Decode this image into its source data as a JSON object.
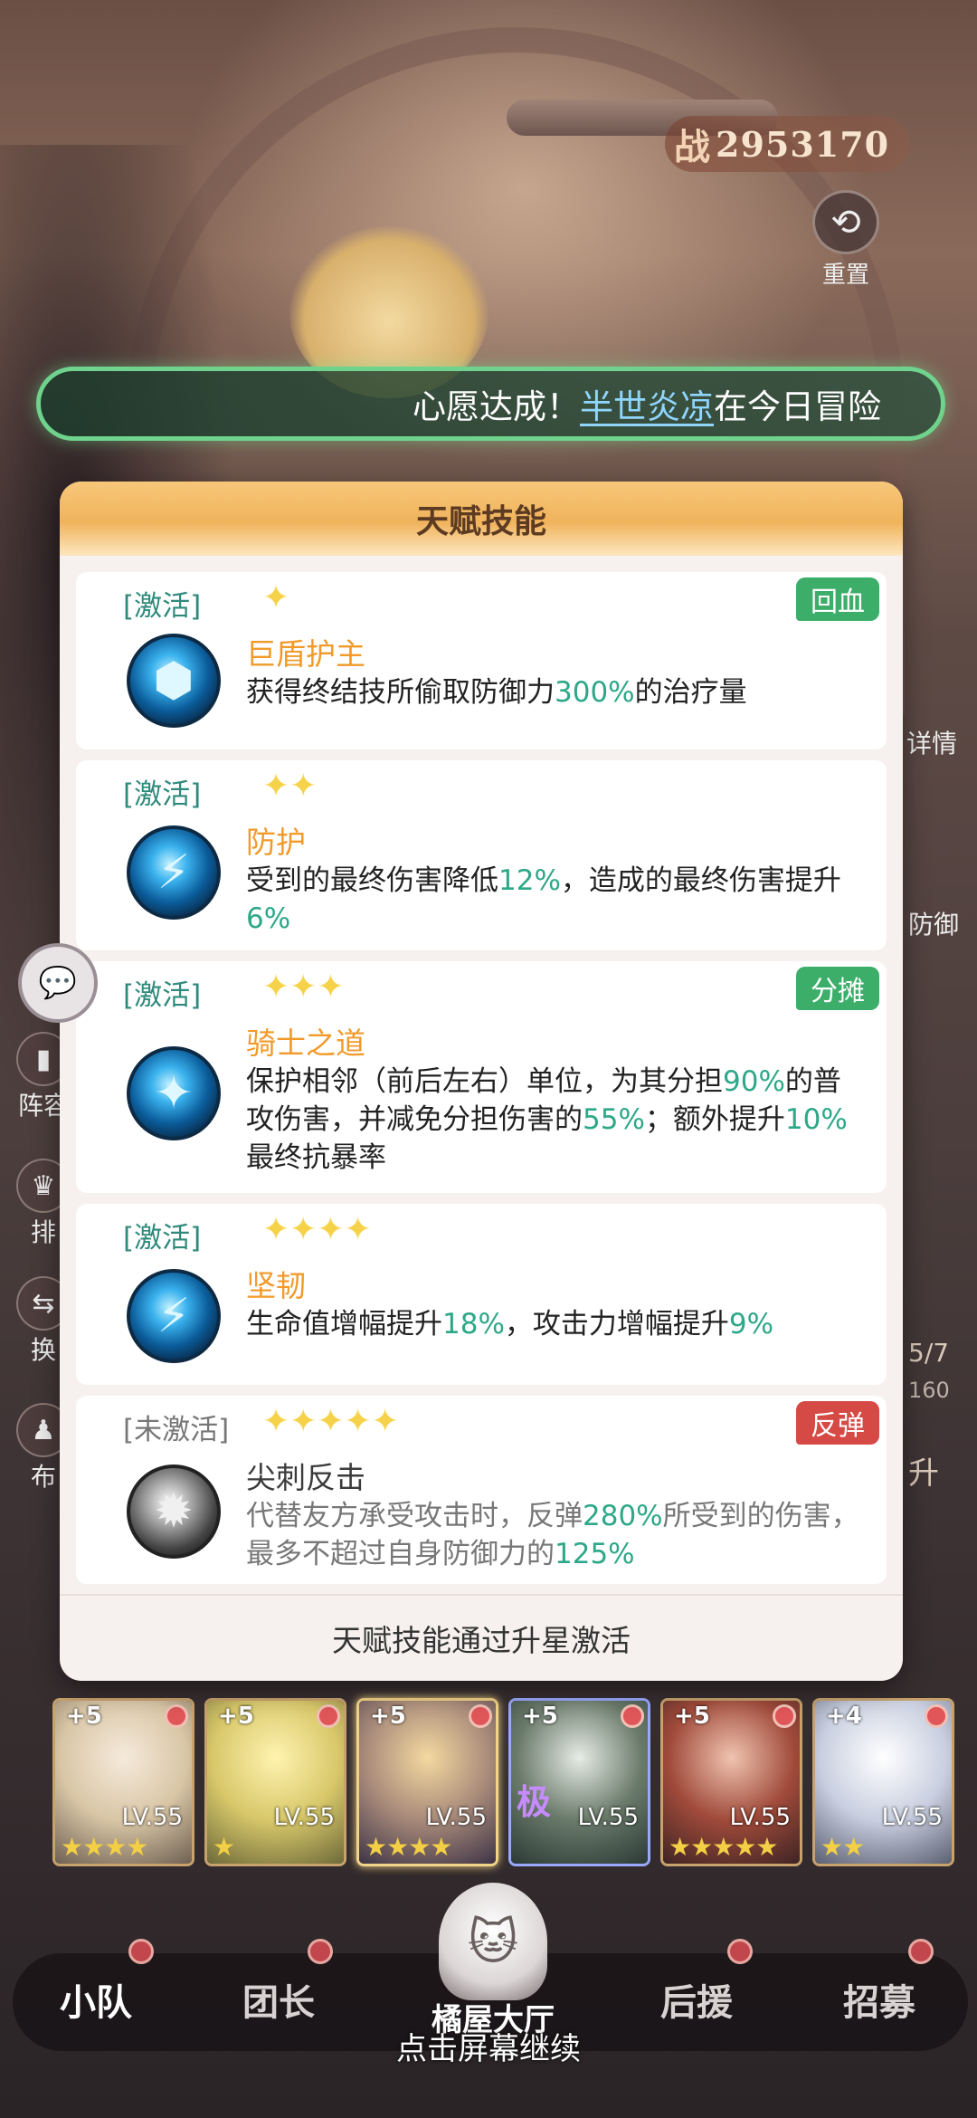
{
  "power": {
    "prefix": "战",
    "value": "2953170"
  },
  "reset": {
    "label": "重置",
    "icon": "reset-icon"
  },
  "wish_banner": {
    "prefix": "心愿达成！",
    "name": "半世炎凉",
    "suffix": "在今日冒险"
  },
  "side_left": [
    {
      "label": "阵容",
      "icon": "formation-icon"
    },
    {
      "label": "排",
      "icon": "rank-icon"
    },
    {
      "label": "换",
      "icon": "swap-icon"
    },
    {
      "label": "布",
      "icon": "deploy-icon"
    }
  ],
  "side_right": {
    "detail": "详情",
    "defense": "防御",
    "progress": "5/7",
    "count": "160",
    "upgrade": "升"
  },
  "modal": {
    "title": "天赋技能",
    "footer": "天赋技能通过升星激活",
    "skills": [
      {
        "state": "[激活]",
        "active": true,
        "stars": "✦",
        "tag": "回血",
        "tag_color": "green",
        "name": "巨盾护主",
        "icon": "shield-skill-icon",
        "desc_parts": [
          "获得终结技所偷取防御力",
          "300%",
          "的治疗量"
        ]
      },
      {
        "state": "[激活]",
        "active": true,
        "stars": "✦✦",
        "tag": "",
        "name": "防护",
        "icon": "guard-skill-icon",
        "desc_parts": [
          "受到的最终伤害降低",
          "12%",
          "，造成的最终伤害提升",
          "6%",
          ""
        ]
      },
      {
        "state": "[激活]",
        "active": true,
        "stars": "✦✦✦",
        "tag": "分摊",
        "tag_color": "green",
        "name": "骑士之道",
        "icon": "knight-skill-icon",
        "desc_parts": [
          "保护相邻（前后左右）单位，为其分担",
          "90%",
          "的普攻伤害，并减免分担伤害的",
          "55%",
          "；额外提升",
          "10%",
          "最终抗暴率"
        ]
      },
      {
        "state": "[激活]",
        "active": true,
        "stars": "✦✦✦✦",
        "tag": "",
        "name": "坚韧",
        "icon": "tenacity-skill-icon",
        "desc_parts": [
          "生命值增幅提升",
          "18%",
          "，攻击力增幅提升",
          "9%",
          ""
        ]
      },
      {
        "state": "[未激活]",
        "active": false,
        "stars": "✦✦✦✦✦",
        "tag": "反弹",
        "tag_color": "red",
        "name": "尖刺反击",
        "icon": "spike-skill-icon",
        "desc_parts": [
          "代替友方承受攻击时，反弹",
          "280%",
          "所受到的伤害，最多不超过自身防御力的",
          "125%",
          ""
        ]
      }
    ]
  },
  "roster": [
    {
      "plus": "+5",
      "level": "LV.55",
      "stars": "★★★★",
      "palette": "#d9c6a6"
    },
    {
      "plus": "+5",
      "level": "LV.55",
      "stars": "★",
      "palette": "#d8c86a"
    },
    {
      "plus": "+5",
      "level": "LV.55",
      "stars": "★★★★",
      "palette": "#a88a7a",
      "selected": true
    },
    {
      "plus": "+5",
      "level": "LV.55",
      "stars": "",
      "palette": "#6a7a6a",
      "badge": "极"
    },
    {
      "plus": "+5",
      "level": "LV.55",
      "stars": "★★★★★",
      "palette": "#a04a3a"
    },
    {
      "plus": "+4",
      "level": "LV.55",
      "stars": "★★",
      "palette": "#c9cfe0"
    }
  ],
  "nav": {
    "items": [
      "小队",
      "团长",
      "后援",
      "招募"
    ],
    "center": "橘屋大厅",
    "active": "小队"
  },
  "tap_hint": "点击屏幕继续"
}
